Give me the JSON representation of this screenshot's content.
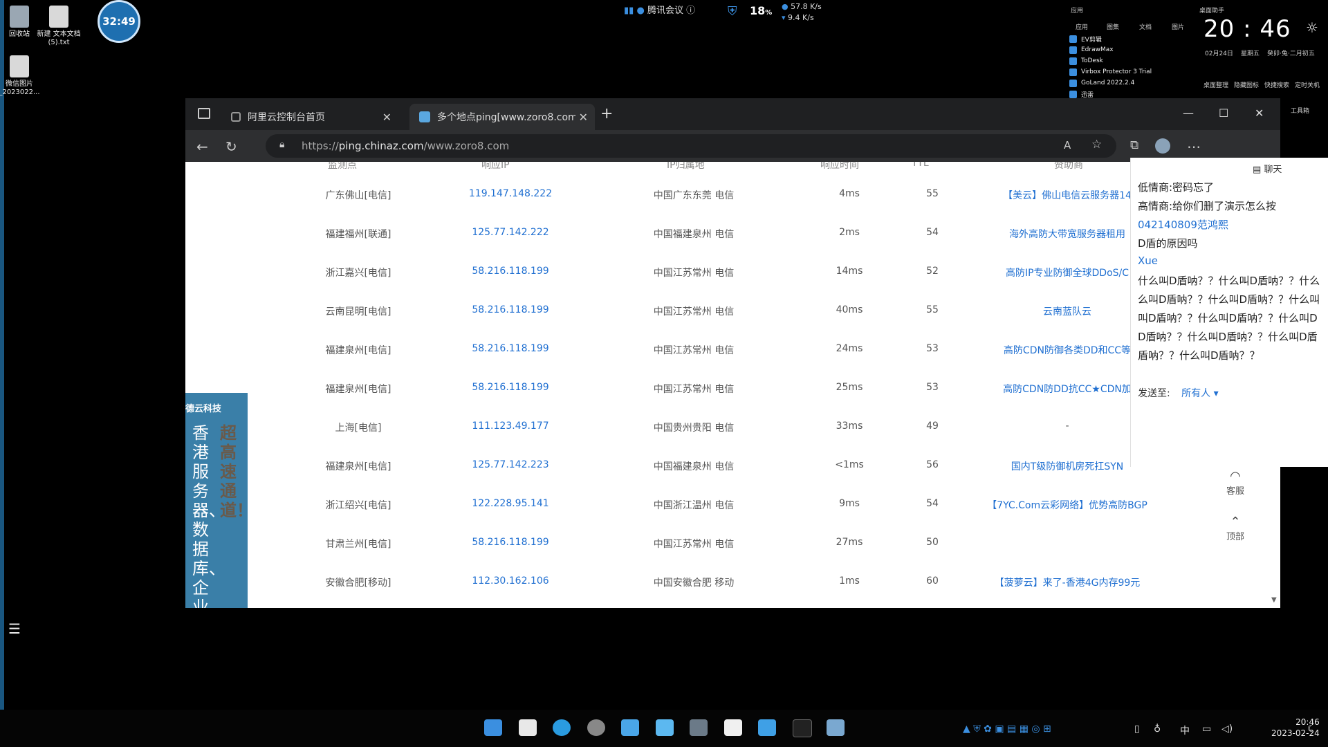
{
  "desktop": {
    "icons": [
      {
        "label": "回收站"
      },
      {
        "label": "新建 文本文档 (5).txt"
      },
      {
        "label": "微信图片_2023022..."
      }
    ],
    "timer": "32:49",
    "meeting_label": "腾讯会议",
    "cpu_percent": "18",
    "cpu_unit": "%",
    "net_up": "57.8 K/s",
    "net_down": "9.4 K/s"
  },
  "widget": {
    "section_apps": "应用",
    "section_desktop": "桌面助手",
    "tabs": [
      "应用",
      "图集",
      "文档",
      "图片"
    ],
    "apps": [
      "EV剪辑",
      "EdrawMax",
      "ToDesk",
      "Virbox Protector 3 Trial",
      "GoLand 2022.2.4",
      "迅雷"
    ],
    "clock": "20 : 46",
    "date": "02月24日",
    "weekday": "星期五",
    "lunar": "癸卯·兔·二月初五",
    "actions": [
      "桌面整理",
      "隐藏图标",
      "快捷搜索",
      "定时关机"
    ],
    "toolbox": "工具箱"
  },
  "browser": {
    "tabs": [
      {
        "label": "阿里云控制台首页",
        "active": false
      },
      {
        "label": "多个地点ping[www.zoro8.com]",
        "active": true
      }
    ],
    "url_scheme": "https://",
    "url_host": "ping.chinaz.com",
    "url_path": "/www.zoro8.com",
    "new_tab": "+"
  },
  "table": {
    "headers": [
      "监测点",
      "响应IP",
      "IP归属地",
      "响应时间",
      "TTL",
      "赞助商"
    ],
    "rows": [
      [
        "广东佛山[电信]",
        "119.147.148.222",
        "中国广东东莞 电信",
        "4ms",
        "55",
        "【美云】佛山电信云服务器14"
      ],
      [
        "福建福州[联通]",
        "125.77.142.222",
        "中国福建泉州 电信",
        "2ms",
        "54",
        "海外高防大带宽服务器租用"
      ],
      [
        "浙江嘉兴[电信]",
        "58.216.118.199",
        "中国江苏常州 电信",
        "14ms",
        "52",
        "高防IP专业防御全球DDoS/C"
      ],
      [
        "云南昆明[电信]",
        "58.216.118.199",
        "中国江苏常州 电信",
        "40ms",
        "55",
        "云南蓝队云"
      ],
      [
        "福建泉州[电信]",
        "58.216.118.199",
        "中国江苏常州 电信",
        "24ms",
        "53",
        "高防CDN防御各类DD和CC等"
      ],
      [
        "福建泉州[电信]",
        "58.216.118.199",
        "中国江苏常州 电信",
        "25ms",
        "53",
        "高防CDN防DD抗CC★CDN加"
      ],
      [
        "上海[电信]",
        "111.123.49.177",
        "中国贵州贵阳 电信",
        "33ms",
        "49",
        "-"
      ],
      [
        "福建泉州[电信]",
        "125.77.142.223",
        "中国福建泉州 电信",
        "<1ms",
        "56",
        "国内T级防御机房死扛SYN"
      ],
      [
        "浙江绍兴[电信]",
        "122.228.95.141",
        "中国浙江温州 电信",
        "9ms",
        "54",
        "【7YC.Com云彩网络】优势高防BGP"
      ],
      [
        "甘肃兰州[电信]",
        "58.216.118.199",
        "中国江苏常州 电信",
        "27ms",
        "50",
        ""
      ],
      [
        "安徽合肥[移动]",
        "112.30.162.106",
        "中国安徽合肥 移动",
        "1ms",
        "60",
        "【菠萝云】来了-香港4G内存99元"
      ]
    ]
  },
  "ad": {
    "brand": "德云科技",
    "text_main": "香港服务器、数据库、企业级",
    "text_side": "超高速通道！"
  },
  "chat": {
    "title": "聊天",
    "lines": [
      {
        "text": "低情商:密码忘了",
        "blue": false
      },
      {
        "text": "高情商:给你们删了演示怎么按",
        "blue": false
      },
      {
        "text": "042140809范鸿熙",
        "blue": true
      },
      {
        "text": "D盾的原因吗",
        "blue": false
      },
      {
        "text": "Xue",
        "blue": true
      },
      {
        "text": "什么叫D盾呐？？什么叫D盾呐？？什么",
        "blue": false
      },
      {
        "text": "么叫D盾呐？？什么叫D盾呐？？什么叫",
        "blue": false
      },
      {
        "text": "叫D盾呐？？什么叫D盾呐？？什么叫D",
        "blue": false
      },
      {
        "text": "D盾呐？？什么叫D盾呐？？什么叫D盾",
        "blue": false
      },
      {
        "text": "盾呐？？什么叫D盾呐？？",
        "blue": false
      }
    ],
    "send_to_label": "发送至:",
    "send_to_value": "所有人"
  },
  "side_buttons": {
    "service": "客服",
    "top": "顶部"
  },
  "taskbar": {
    "ime": "中",
    "time": "20:46",
    "date": "2023-02-24"
  }
}
